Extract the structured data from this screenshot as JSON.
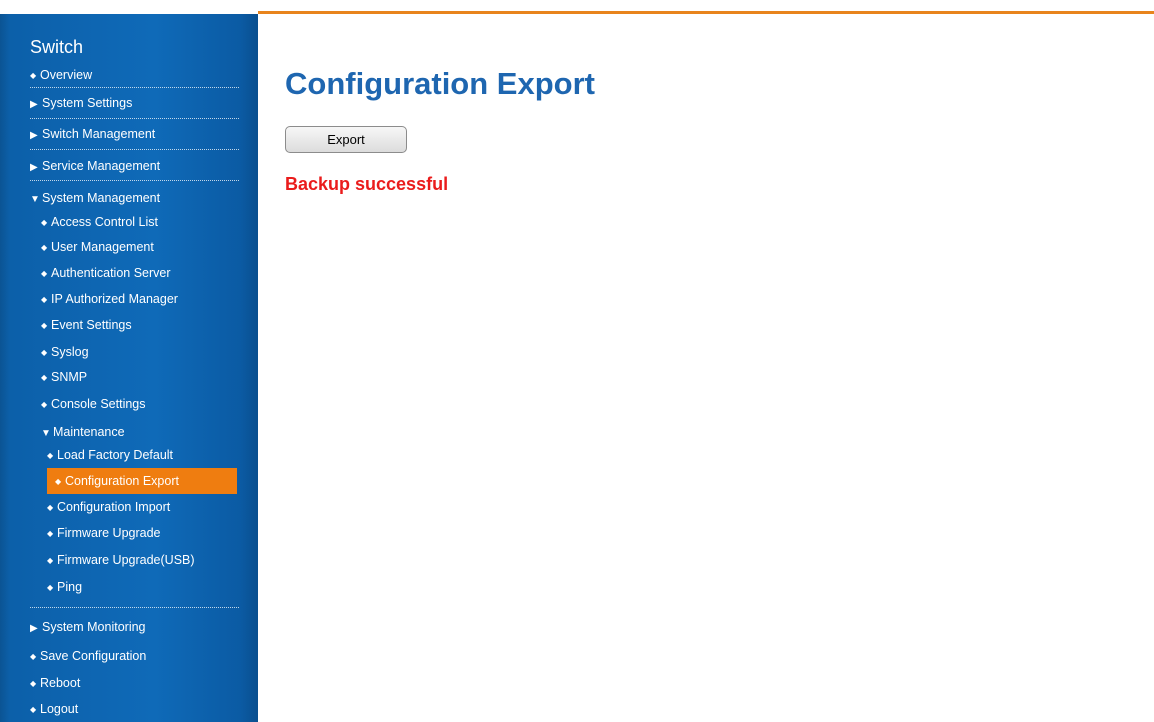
{
  "sidebar": {
    "brand": "Switch",
    "items": {
      "overview": "Overview",
      "system_settings": "System Settings",
      "switch_management": "Switch Management",
      "service_management": "Service Management",
      "system_management": "System Management",
      "access_control_list": "Access Control List",
      "user_management": "User Management",
      "authentication_server": "Authentication Server",
      "ip_authorized_manager": "IP Authorized Manager",
      "event_settings": "Event Settings",
      "syslog": "Syslog",
      "snmp": "SNMP",
      "console_settings": "Console Settings",
      "maintenance": "Maintenance",
      "load_factory_default": "Load Factory Default",
      "configuration_export": "Configuration Export",
      "configuration_import": "Configuration Import",
      "firmware_upgrade": "Firmware Upgrade",
      "firmware_upgrade_usb": "Firmware Upgrade(USB)",
      "ping": "Ping",
      "system_monitoring": "System Monitoring",
      "save_configuration": "Save Configuration",
      "reboot": "Reboot",
      "logout": "Logout"
    },
    "active_item": "Configuration Export",
    "accent_color": "#ef7d10",
    "background_color": "#0f6ab8"
  },
  "main": {
    "title": "Configuration Export",
    "export_button_label": "Export",
    "status_message": "Backup successful",
    "title_color": "#1e66b0",
    "status_color": "#ea1c1c"
  },
  "icons": {
    "bullet": "bullet-icon",
    "collapsed": "triangle-right-icon",
    "expanded": "triangle-down-icon"
  }
}
